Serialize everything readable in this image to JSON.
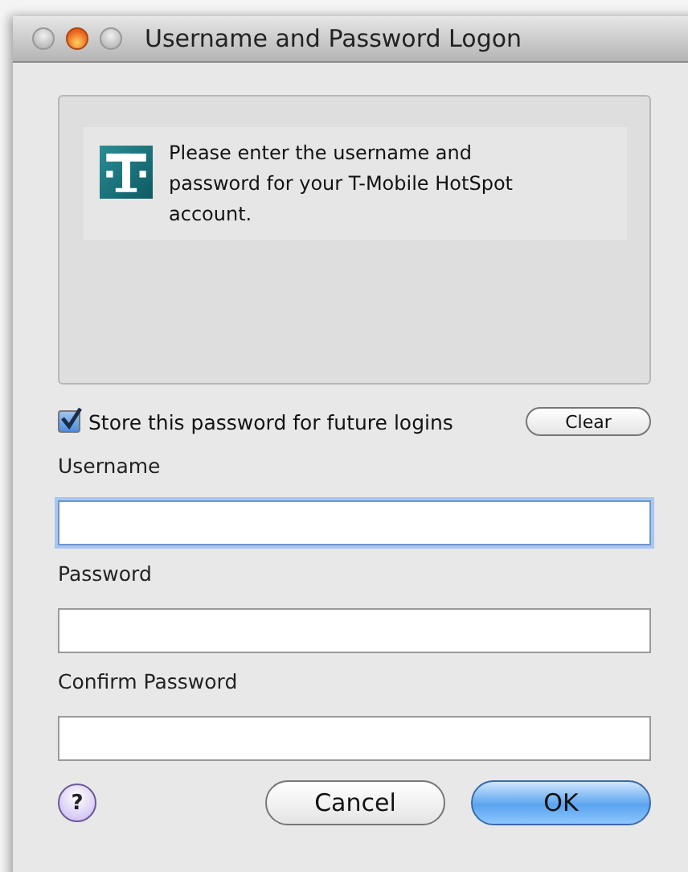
{
  "window": {
    "title": "Username and Password Logon"
  },
  "message": "Please enter the username and password for your T-Mobile HotSpot account.",
  "store_password": {
    "label": "Store this password for future logins",
    "checked": true
  },
  "clear_button": "Clear",
  "fields": [
    {
      "label": "Username",
      "focused": true
    },
    {
      "label": "Password",
      "focused": false
    },
    {
      "label": "Confirm Password",
      "focused": false
    }
  ],
  "help_button": "?",
  "buttons": [
    {
      "label": "Cancel",
      "default": false
    },
    {
      "label": "OK",
      "default": true
    }
  ]
}
